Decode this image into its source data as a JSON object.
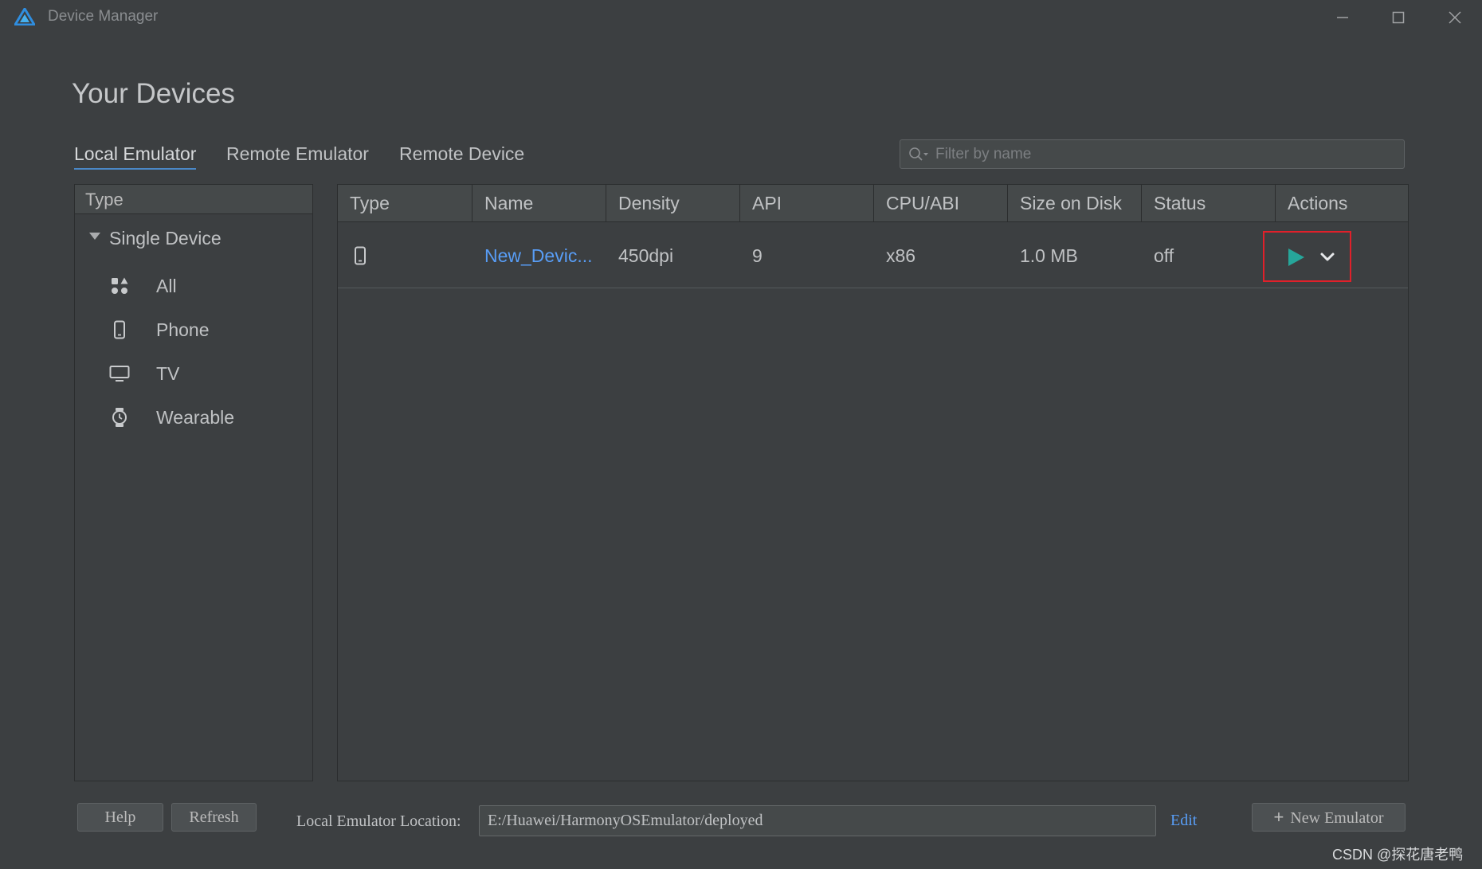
{
  "window": {
    "title": "Device Manager"
  },
  "page": {
    "title": "Your Devices"
  },
  "tabs": [
    {
      "label": "Local Emulator",
      "active": true
    },
    {
      "label": "Remote Emulator",
      "active": false
    },
    {
      "label": "Remote Device",
      "active": false
    }
  ],
  "search": {
    "placeholder": "Filter by name",
    "value": ""
  },
  "sidebar": {
    "header": "Type",
    "group_label": "Single Device",
    "group_expanded": true,
    "categories": [
      {
        "label": "All",
        "icon": "grid-icon"
      },
      {
        "label": "Phone",
        "icon": "phone-icon"
      },
      {
        "label": "TV",
        "icon": "tv-icon"
      },
      {
        "label": "Wearable",
        "icon": "watch-icon"
      }
    ]
  },
  "table": {
    "columns": [
      "Type",
      "Name",
      "Density",
      "API",
      "CPU/ABI",
      "Size on Disk",
      "Status",
      "Actions"
    ],
    "rows": [
      {
        "type_icon": "phone-icon",
        "name": "New_Devic...",
        "density": "450dpi",
        "api": "9",
        "cpu_abi": "x86",
        "size": "1.0 MB",
        "status": "off"
      }
    ]
  },
  "footer": {
    "help_label": "Help",
    "refresh_label": "Refresh",
    "location_label": "Local Emulator Location:",
    "location_value": "E:/Huawei/HarmonyOSEmulator/deployed",
    "edit_label": "Edit",
    "new_emulator_label": "New Emulator"
  },
  "watermark": "CSDN @探花唐老鸭",
  "colors": {
    "background": "#3c3f41",
    "accent_link": "#589df6",
    "tab_underline": "#4a88c7",
    "play": "#26a69a",
    "highlight_box": "#e0202a"
  }
}
